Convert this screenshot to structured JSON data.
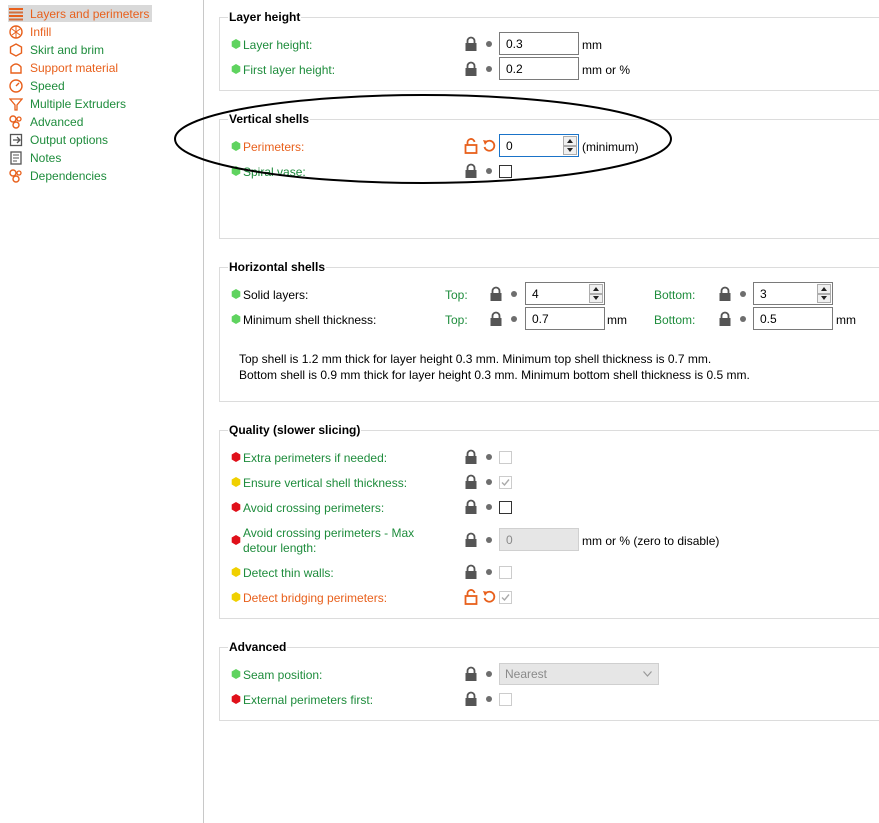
{
  "sidebar": {
    "items": [
      {
        "label": "Layers and perimeters",
        "color": "#e8601c",
        "icon": "layers-icon"
      },
      {
        "label": "Infill",
        "color": "#e8601c",
        "icon": "infill-icon"
      },
      {
        "label": "Skirt and brim",
        "color": "#1e8c3c",
        "icon": "skirt-icon"
      },
      {
        "label": "Support material",
        "color": "#e8601c",
        "icon": "support-icon"
      },
      {
        "label": "Speed",
        "color": "#1e8c3c",
        "icon": "speed-icon"
      },
      {
        "label": "Multiple Extruders",
        "color": "#1e8c3c",
        "icon": "extruder-icon"
      },
      {
        "label": "Advanced",
        "color": "#1e8c3c",
        "icon": "wrench-icon"
      },
      {
        "label": "Output options",
        "color": "#1e8c3c",
        "icon": "output-icon"
      },
      {
        "label": "Notes",
        "color": "#1e8c3c",
        "icon": "notes-icon"
      },
      {
        "label": "Dependencies",
        "color": "#1e8c3c",
        "icon": "dependencies-icon"
      }
    ]
  },
  "layer_height": {
    "title": "Layer height",
    "layer_height_label": "Layer height:",
    "layer_height_value": "0.3",
    "layer_height_unit": "mm",
    "first_layer_label": "First layer height:",
    "first_layer_value": "0.2",
    "first_layer_unit": "mm or %"
  },
  "vertical_shells": {
    "title": "Vertical shells",
    "perimeters_label": "Perimeters:",
    "perimeters_value": "0",
    "perimeters_unit": "(minimum)",
    "spiral_vase_label": "Spiral vase:"
  },
  "horizontal_shells": {
    "title": "Horizontal shells",
    "solid_layers_label": "Solid layers:",
    "top_label": "Top:",
    "bottom_label": "Bottom:",
    "solid_top_value": "4",
    "solid_bottom_value": "3",
    "min_thickness_label": "Minimum shell thickness:",
    "min_top_value": "0.7",
    "min_bottom_value": "0.5",
    "unit_mm": "mm",
    "note_line1": "Top shell is 1.2 mm thick for layer height 0.3 mm. Minimum top shell thickness is 0.7 mm.",
    "note_line2": "Bottom shell is 0.9 mm thick for layer height 0.3 mm. Minimum bottom shell thickness is 0.5 mm."
  },
  "quality": {
    "title": "Quality (slower slicing)",
    "extra_perimeters_label": "Extra perimeters if needed:",
    "ensure_vertical_label": "Ensure vertical shell thickness:",
    "avoid_crossing_label": "Avoid crossing perimeters:",
    "avoid_crossing_max_label_1": "Avoid crossing perimeters - Max",
    "avoid_crossing_max_label_2": "detour length:",
    "avoid_crossing_max_value": "0",
    "avoid_crossing_max_unit": "mm or % (zero to disable)",
    "thin_walls_label": "Detect thin walls:",
    "bridging_label": "Detect bridging perimeters:"
  },
  "advanced": {
    "title": "Advanced",
    "seam_label": "Seam position:",
    "seam_value": "Nearest",
    "external_first_label": "External perimeters first:"
  },
  "colors": {
    "modified": "#e8601c",
    "green_label": "#1e8c3c",
    "simple": "#5fd35f",
    "advanced": "#f0d000",
    "expert": "#e0101a"
  }
}
